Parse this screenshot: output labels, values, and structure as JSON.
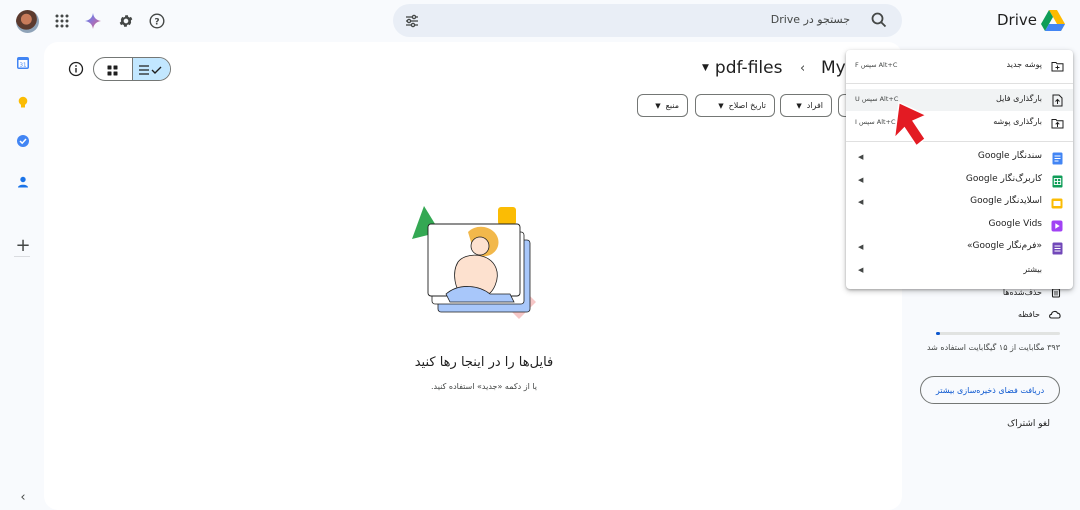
{
  "header": {
    "app_title": "Drive",
    "search_placeholder": "جستجو در Drive"
  },
  "toolbar": {
    "folder_name": "pdf-files",
    "breadcrumb_parent": "My"
  },
  "filters": [
    {
      "label": "نوع"
    },
    {
      "label": "افراد"
    },
    {
      "label": "تاریخ اصلاح"
    },
    {
      "label": "منبع"
    }
  ],
  "empty_state": {
    "title": "فایل‌ها را در اینجا رها کنید",
    "subtitle": "یا از دکمه «جدید» استفاده کنید."
  },
  "menu": {
    "items": [
      {
        "label": "پوشه جدید",
        "shortcut": "Alt+C سپس F",
        "icon": "new-folder-icon"
      },
      {
        "label": "بارگذاری فایل",
        "shortcut": "Alt+C سپس U",
        "icon": "file-upload-icon"
      },
      {
        "label": "بارگذاری پوشه",
        "shortcut": "Alt+C سپس I",
        "icon": "folder-upload-icon"
      },
      {
        "label": "سندنگار Google",
        "icon": "docs-icon"
      },
      {
        "label": "کاربرگ‌نگار Google",
        "icon": "sheets-icon"
      },
      {
        "label": "اسلایدنگار Google",
        "icon": "slides-icon"
      },
      {
        "label": "Google Vids",
        "icon": "vids-icon"
      },
      {
        "label": "«فرم‌نگار Google»",
        "icon": "forms-icon"
      },
      {
        "label": "بیشتر",
        "icon": "more"
      }
    ]
  },
  "right_nav": {
    "trash_label": "حذف‌شده‌ها",
    "storage_label": "حافظه",
    "storage_text": "۳۹۳ مگابایت از ۱۵ گیگابایت استفاده شد",
    "storage_fraction": 0.03,
    "get_storage_label": "دریافت فضای ذخیره‌سازی بیشتر",
    "cancel_subscription_label": "لغو اشتراک"
  },
  "colors": {
    "accent": "#0b57d0",
    "selected_toggle": "#c2e7ff",
    "background": "#f8fafd"
  }
}
